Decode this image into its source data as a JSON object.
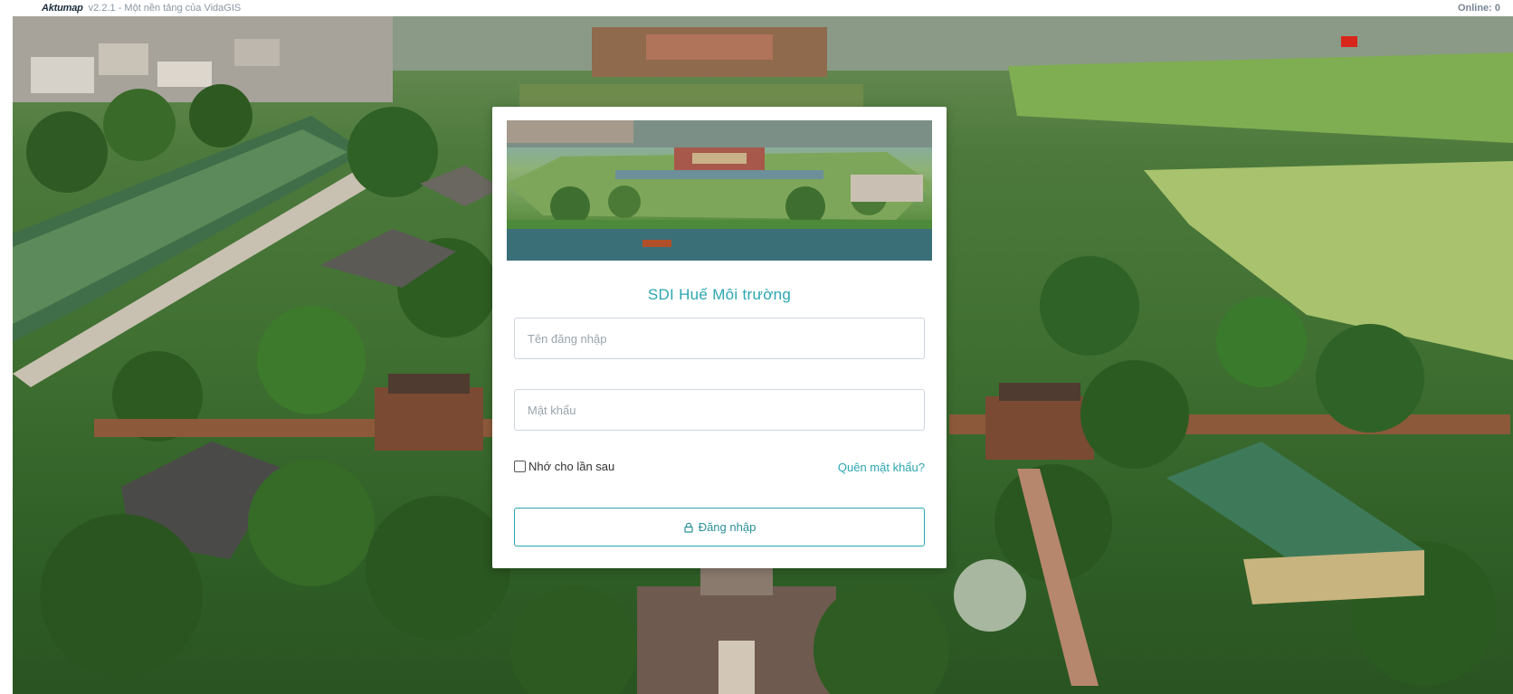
{
  "topbar": {
    "brand": "Aktumap",
    "version_text": "v2.2.1 - Một nền tảng của VidaGIS",
    "online_text": "Online: 0"
  },
  "login": {
    "title": "SDI Huế Môi trường",
    "username_placeholder": "Tên đăng nhập",
    "password_placeholder": "Mật khẩu",
    "remember_label": "Nhớ cho lần sau",
    "remember_checked": false,
    "forgot_label": "Quên mật khẩu?",
    "submit_label": "Đăng nhập",
    "submit_icon": "lock-icon"
  },
  "colors": {
    "accent": "#2ba6b0",
    "border": "#cfd6dd",
    "placeholder": "#9aa4ad"
  }
}
